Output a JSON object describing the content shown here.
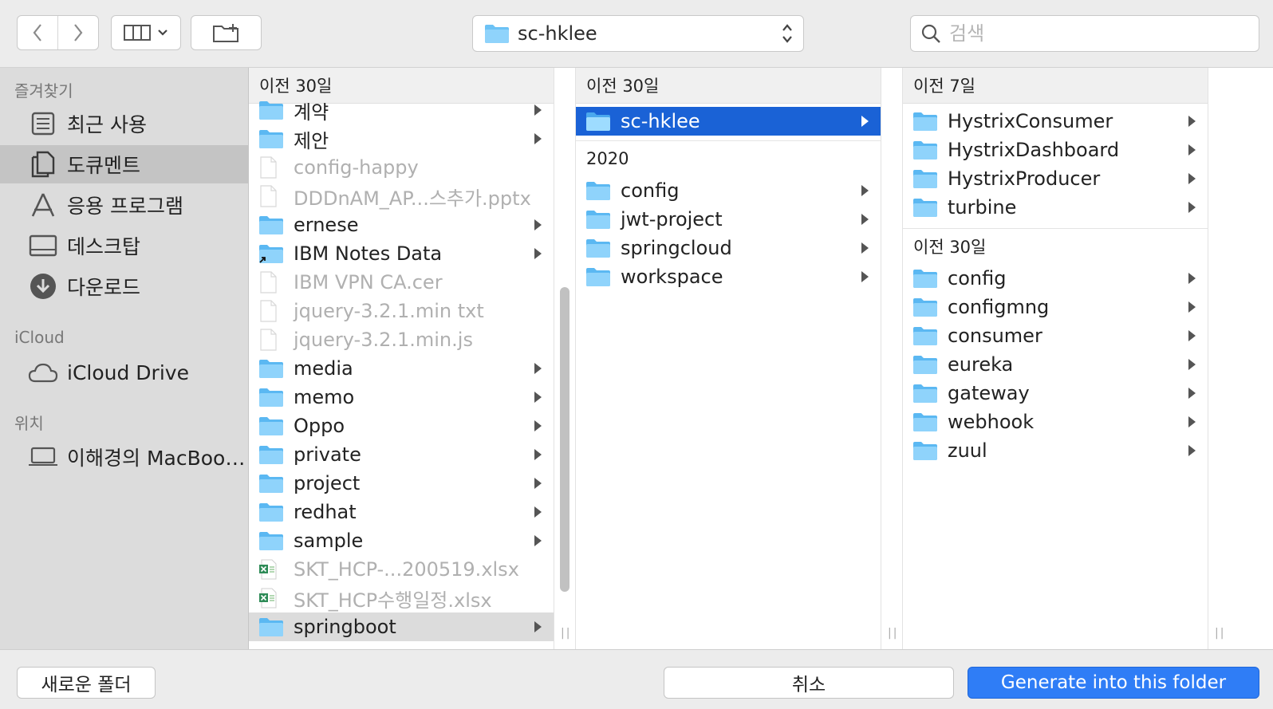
{
  "toolbar": {
    "back_icon": "chevron-left-icon",
    "forward_icon": "chevron-right-icon",
    "view_icon": "column-view-icon",
    "new_folder_icon": "new-folder-icon",
    "path_label": "sc-hklee",
    "search_placeholder": "검색"
  },
  "sidebar": {
    "favorites_header": "즐겨찾기",
    "favorites": [
      {
        "label": "최근 사용",
        "icon": "recents-icon"
      },
      {
        "label": "도큐멘트",
        "icon": "documents-icon"
      },
      {
        "label": "응용 프로그램",
        "icon": "applications-icon"
      },
      {
        "label": "데스크탑",
        "icon": "desktop-icon"
      },
      {
        "label": "다운로드",
        "icon": "downloads-icon"
      }
    ],
    "icloud_header": "iCloud",
    "icloud_items": [
      {
        "label": "iCloud Drive",
        "icon": "cloud-icon"
      }
    ],
    "locations_header": "위치",
    "locations": [
      {
        "label": "이해경의 MacBoo…",
        "icon": "laptop-icon"
      }
    ]
  },
  "column1": {
    "header": "이전 30일",
    "items": [
      {
        "label": "계약",
        "type": "folder",
        "arrow": true
      },
      {
        "label": "제안",
        "type": "folder",
        "arrow": true
      },
      {
        "label": "config-happy",
        "type": "file",
        "dim": true
      },
      {
        "label": "DDDnAM_AP...스추가.pptx",
        "type": "file",
        "dim": true
      },
      {
        "label": "ernese",
        "type": "folder",
        "arrow": true
      },
      {
        "label": "IBM Notes Data",
        "type": "folder-alias",
        "arrow": true
      },
      {
        "label": "IBM VPN CA.cer",
        "type": "file",
        "dim": true
      },
      {
        "label": "jquery-3.2.1.min txt",
        "type": "file",
        "dim": true
      },
      {
        "label": "jquery-3.2.1.min.js",
        "type": "file",
        "dim": true
      },
      {
        "label": "media",
        "type": "folder",
        "arrow": true
      },
      {
        "label": "memo",
        "type": "folder",
        "arrow": true
      },
      {
        "label": "Oppo",
        "type": "folder",
        "arrow": true
      },
      {
        "label": "private",
        "type": "folder",
        "arrow": true
      },
      {
        "label": "project",
        "type": "folder",
        "arrow": true
      },
      {
        "label": "redhat",
        "type": "folder",
        "arrow": true
      },
      {
        "label": "sample",
        "type": "folder",
        "arrow": true
      },
      {
        "label": "SKT_HCP-...200519.xlsx",
        "type": "excel",
        "dim": true
      },
      {
        "label": "SKT_HCP수행일정.xlsx",
        "type": "excel",
        "dim": true
      },
      {
        "label": "springboot",
        "type": "folder",
        "arrow": true,
        "selected": true
      }
    ]
  },
  "column2": {
    "header": "이전 30일",
    "top_items": [
      {
        "label": "sc-hklee",
        "type": "folder",
        "arrow": true,
        "selected": true
      }
    ],
    "group2_header": "2020",
    "group2_items": [
      {
        "label": "config",
        "type": "folder",
        "arrow": true
      },
      {
        "label": "jwt-project",
        "type": "folder",
        "arrow": true
      },
      {
        "label": "springcloud",
        "type": "folder",
        "arrow": true
      },
      {
        "label": "workspace",
        "type": "folder",
        "arrow": true
      }
    ]
  },
  "column3": {
    "header": "이전 7일",
    "top_items": [
      {
        "label": "HystrixConsumer",
        "type": "folder",
        "arrow": true
      },
      {
        "label": "HystrixDashboard",
        "type": "folder",
        "arrow": true
      },
      {
        "label": "HystrixProducer",
        "type": "folder",
        "arrow": true
      },
      {
        "label": "turbine",
        "type": "folder",
        "arrow": true
      }
    ],
    "group2_header": "이전 30일",
    "group2_items": [
      {
        "label": "config",
        "type": "folder",
        "arrow": true
      },
      {
        "label": "configmng",
        "type": "folder",
        "arrow": true
      },
      {
        "label": "consumer",
        "type": "folder",
        "arrow": true
      },
      {
        "label": "eureka",
        "type": "folder",
        "arrow": true
      },
      {
        "label": "gateway",
        "type": "folder",
        "arrow": true
      },
      {
        "label": "webhook",
        "type": "folder",
        "arrow": true
      },
      {
        "label": "zuul",
        "type": "folder",
        "arrow": true
      }
    ]
  },
  "footer": {
    "new_folder_label": "새로운 폴더",
    "cancel_label": "취소",
    "confirm_label": "Generate into this folder"
  },
  "colors": {
    "accent": "#2f7df6",
    "selection": "#1a62d6",
    "folder": "#6cc2f5"
  }
}
